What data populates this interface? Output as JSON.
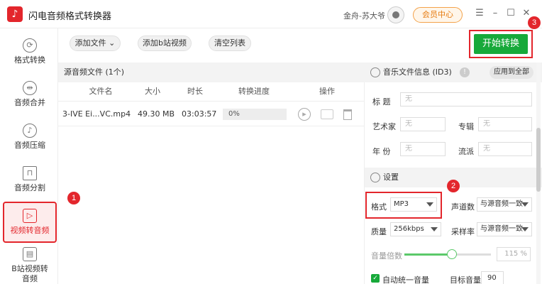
{
  "app": {
    "title": "闪电音频格式转换器",
    "logo_glyph": "♪"
  },
  "header": {
    "user_name": "金舟-苏大爷",
    "member_label": "会员中心",
    "menu_glyph": "☰",
    "min_glyph": "–",
    "max_glyph": "☐",
    "close_glyph": "✕"
  },
  "sidebar": {
    "items": [
      {
        "label": "格式转换",
        "glyph": "⟳"
      },
      {
        "label": "音频合并",
        "glyph": "⇹"
      },
      {
        "label": "音频压缩",
        "glyph": "♪"
      },
      {
        "label": "音频分割",
        "glyph": "⊓"
      },
      {
        "label": "视频转音频",
        "glyph": "▷"
      },
      {
        "label": "B站视频转",
        "label2": "音频",
        "glyph": "▤"
      }
    ]
  },
  "toolbar": {
    "add_file": "添加文件",
    "add_file_caret": "⌄",
    "add_bilibili": "添加b站视频",
    "clear_list": "清空列表",
    "start": "开始转换"
  },
  "file_list": {
    "header": "源音频文件 (1个)",
    "columns": [
      "文件名",
      "大小",
      "时长",
      "转换进度",
      "操作"
    ],
    "rows": [
      {
        "name": "3-IVE Ei...VC.mp4",
        "size": "49.30 MB",
        "duration": "03:03:57",
        "progress": "0%",
        "progress_value": 0
      }
    ]
  },
  "id3": {
    "header": "音乐文件信息 (ID3)",
    "info_glyph": "!",
    "apply_all": "应用到全部",
    "title_label": "标  题",
    "artist_label": "艺术家",
    "album_label": "专辑",
    "year_label": "年  份",
    "genre_label": "流派",
    "placeholder": "无"
  },
  "settings": {
    "header": "设置",
    "format_label": "格式",
    "format_value": "MP3",
    "channel_label": "声道数",
    "channel_value": "与源音频一致",
    "quality_label": "质量",
    "quality_value": "256kbps",
    "sample_label": "采样率",
    "sample_value": "与源音频一致",
    "volume_label": "音量倍数",
    "volume_value": "115",
    "volume_unit": "%",
    "volume_level": 0.55,
    "auto_volume_label": "自动统一音量",
    "auto_volume_checked": true,
    "check_glyph": "✓",
    "target_label": "目标音量",
    "target_value": "90"
  },
  "badges": {
    "one": "1",
    "two": "2",
    "three": "3"
  },
  "colors": {
    "accent_red": "#e3262c",
    "accent_green": "#17a93a"
  }
}
